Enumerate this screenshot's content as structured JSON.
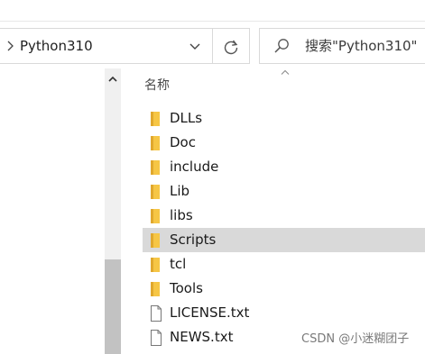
{
  "address": {
    "path": "Python310"
  },
  "search": {
    "placeholder": "搜索\"Python310\""
  },
  "columns": {
    "name": "名称"
  },
  "items": [
    {
      "name": "DLLs",
      "type": "folder"
    },
    {
      "name": "Doc",
      "type": "folder"
    },
    {
      "name": "include",
      "type": "folder"
    },
    {
      "name": "Lib",
      "type": "folder"
    },
    {
      "name": "libs",
      "type": "folder"
    },
    {
      "name": "Scripts",
      "type": "folder",
      "selected": true
    },
    {
      "name": "tcl",
      "type": "folder"
    },
    {
      "name": "Tools",
      "type": "folder"
    },
    {
      "name": "LICENSE.txt",
      "type": "file"
    },
    {
      "name": "NEWS.txt",
      "type": "file"
    }
  ],
  "watermark": "CSDN @小迷糊团子",
  "colors": {
    "folder": "#f6c645",
    "folder_dark": "#e0a82e",
    "selection": "#d9d9d9",
    "scroll_thumb": "#c2c2c2"
  },
  "icons": {
    "breadcrumb": "chevron-right-icon",
    "dropdown": "chevron-down-icon",
    "refresh": "refresh-icon",
    "search": "search-icon",
    "scroll_up": "chevron-up-icon",
    "sort": "sort-asc-icon",
    "folder": "folder-icon",
    "file": "text-file-icon"
  }
}
